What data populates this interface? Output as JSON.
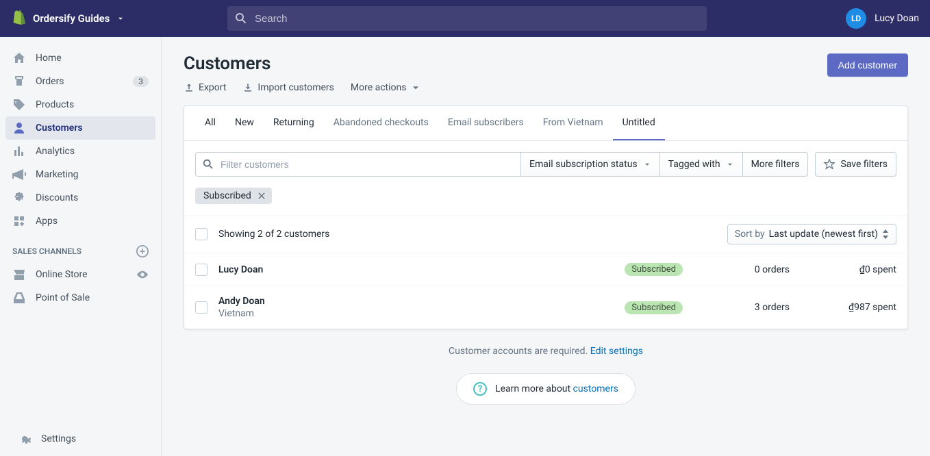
{
  "topbar": {
    "store_name": "Ordersify Guides",
    "search_placeholder": "Search",
    "user_initials": "LD",
    "user_name": "Lucy Doan"
  },
  "sidebar": {
    "items": [
      {
        "label": "Home"
      },
      {
        "label": "Orders",
        "badge": "3"
      },
      {
        "label": "Products"
      },
      {
        "label": "Customers"
      },
      {
        "label": "Analytics"
      },
      {
        "label": "Marketing"
      },
      {
        "label": "Discounts"
      },
      {
        "label": "Apps"
      }
    ],
    "section_title": "SALES CHANNELS",
    "channels": [
      {
        "label": "Online Store"
      },
      {
        "label": "Point of Sale"
      }
    ],
    "settings": "Settings"
  },
  "page": {
    "title": "Customers",
    "actions": {
      "export": "Export",
      "import": "Import customers",
      "more": "More actions",
      "add": "Add customer"
    }
  },
  "tabs": [
    {
      "label": "All"
    },
    {
      "label": "New"
    },
    {
      "label": "Returning"
    },
    {
      "label": "Abandoned checkouts"
    },
    {
      "label": "Email subscribers"
    },
    {
      "label": "From Vietnam"
    },
    {
      "label": "Untitled"
    }
  ],
  "filters": {
    "search_placeholder": "Filter customers",
    "email_status": "Email subscription status",
    "tagged": "Tagged with",
    "more": "More filters",
    "save": "Save filters",
    "applied": {
      "label": "Subscribed"
    }
  },
  "list": {
    "summary": "Showing 2 of 2 customers",
    "sort_prefix": "Sort by ",
    "sort_value": "Last update (newest first)",
    "rows": [
      {
        "name": "Lucy Doan",
        "location": "",
        "status": "Subscribed",
        "orders": "0 orders",
        "spent": "₫0 spent"
      },
      {
        "name": "Andy Doan",
        "location": "Vietnam",
        "status": "Subscribed",
        "orders": "3 orders",
        "spent": "₫987 spent"
      }
    ]
  },
  "footer": {
    "note_text": "Customer accounts are required. ",
    "note_link": "Edit settings",
    "learn_text": "Learn more about ",
    "learn_link": "customers"
  }
}
